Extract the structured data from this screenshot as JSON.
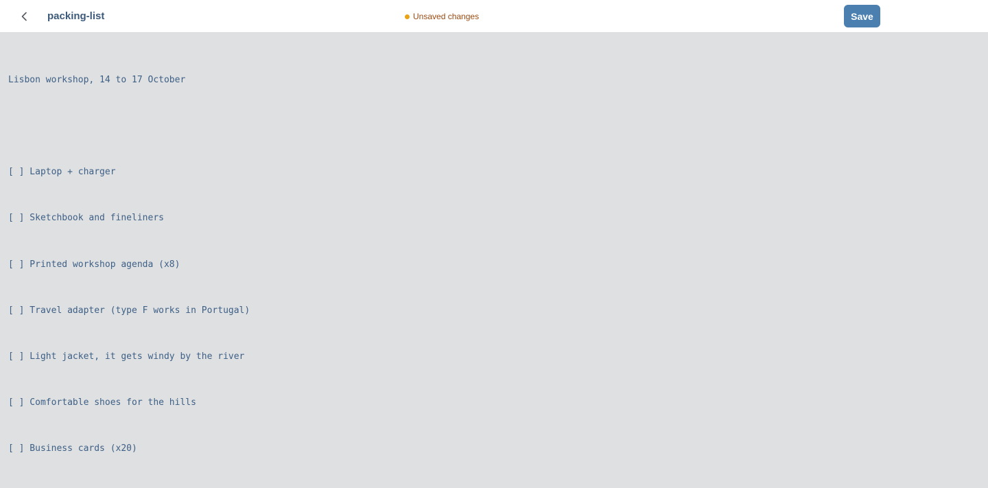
{
  "colors": {
    "accent": "#4a7fb0",
    "title": "#3d5a7a",
    "status_dot": "#e8a317",
    "status_text": "#9a4a10",
    "editor_text": "#3d5f85",
    "editor_bg": "#dfe0e2"
  },
  "header": {
    "back_icon": "chevron-left-icon",
    "filename": "packing-list",
    "status": "Unsaved changes",
    "save_label": "Save"
  },
  "editor": {
    "lines": [
      "Lisbon workshop, 14 to 17 October",
      "",
      "[ ] Laptop + charger",
      "[ ] Sketchbook and fineliners",
      "[ ] Printed workshop agenda (x8)",
      "[ ] Travel adapter (type F works in Portugal)",
      "[ ] Light jacket, it gets windy by the river",
      "[ ] Comfortable shoes for the hills",
      "[ ] Business cards (x20)"
    ]
  }
}
